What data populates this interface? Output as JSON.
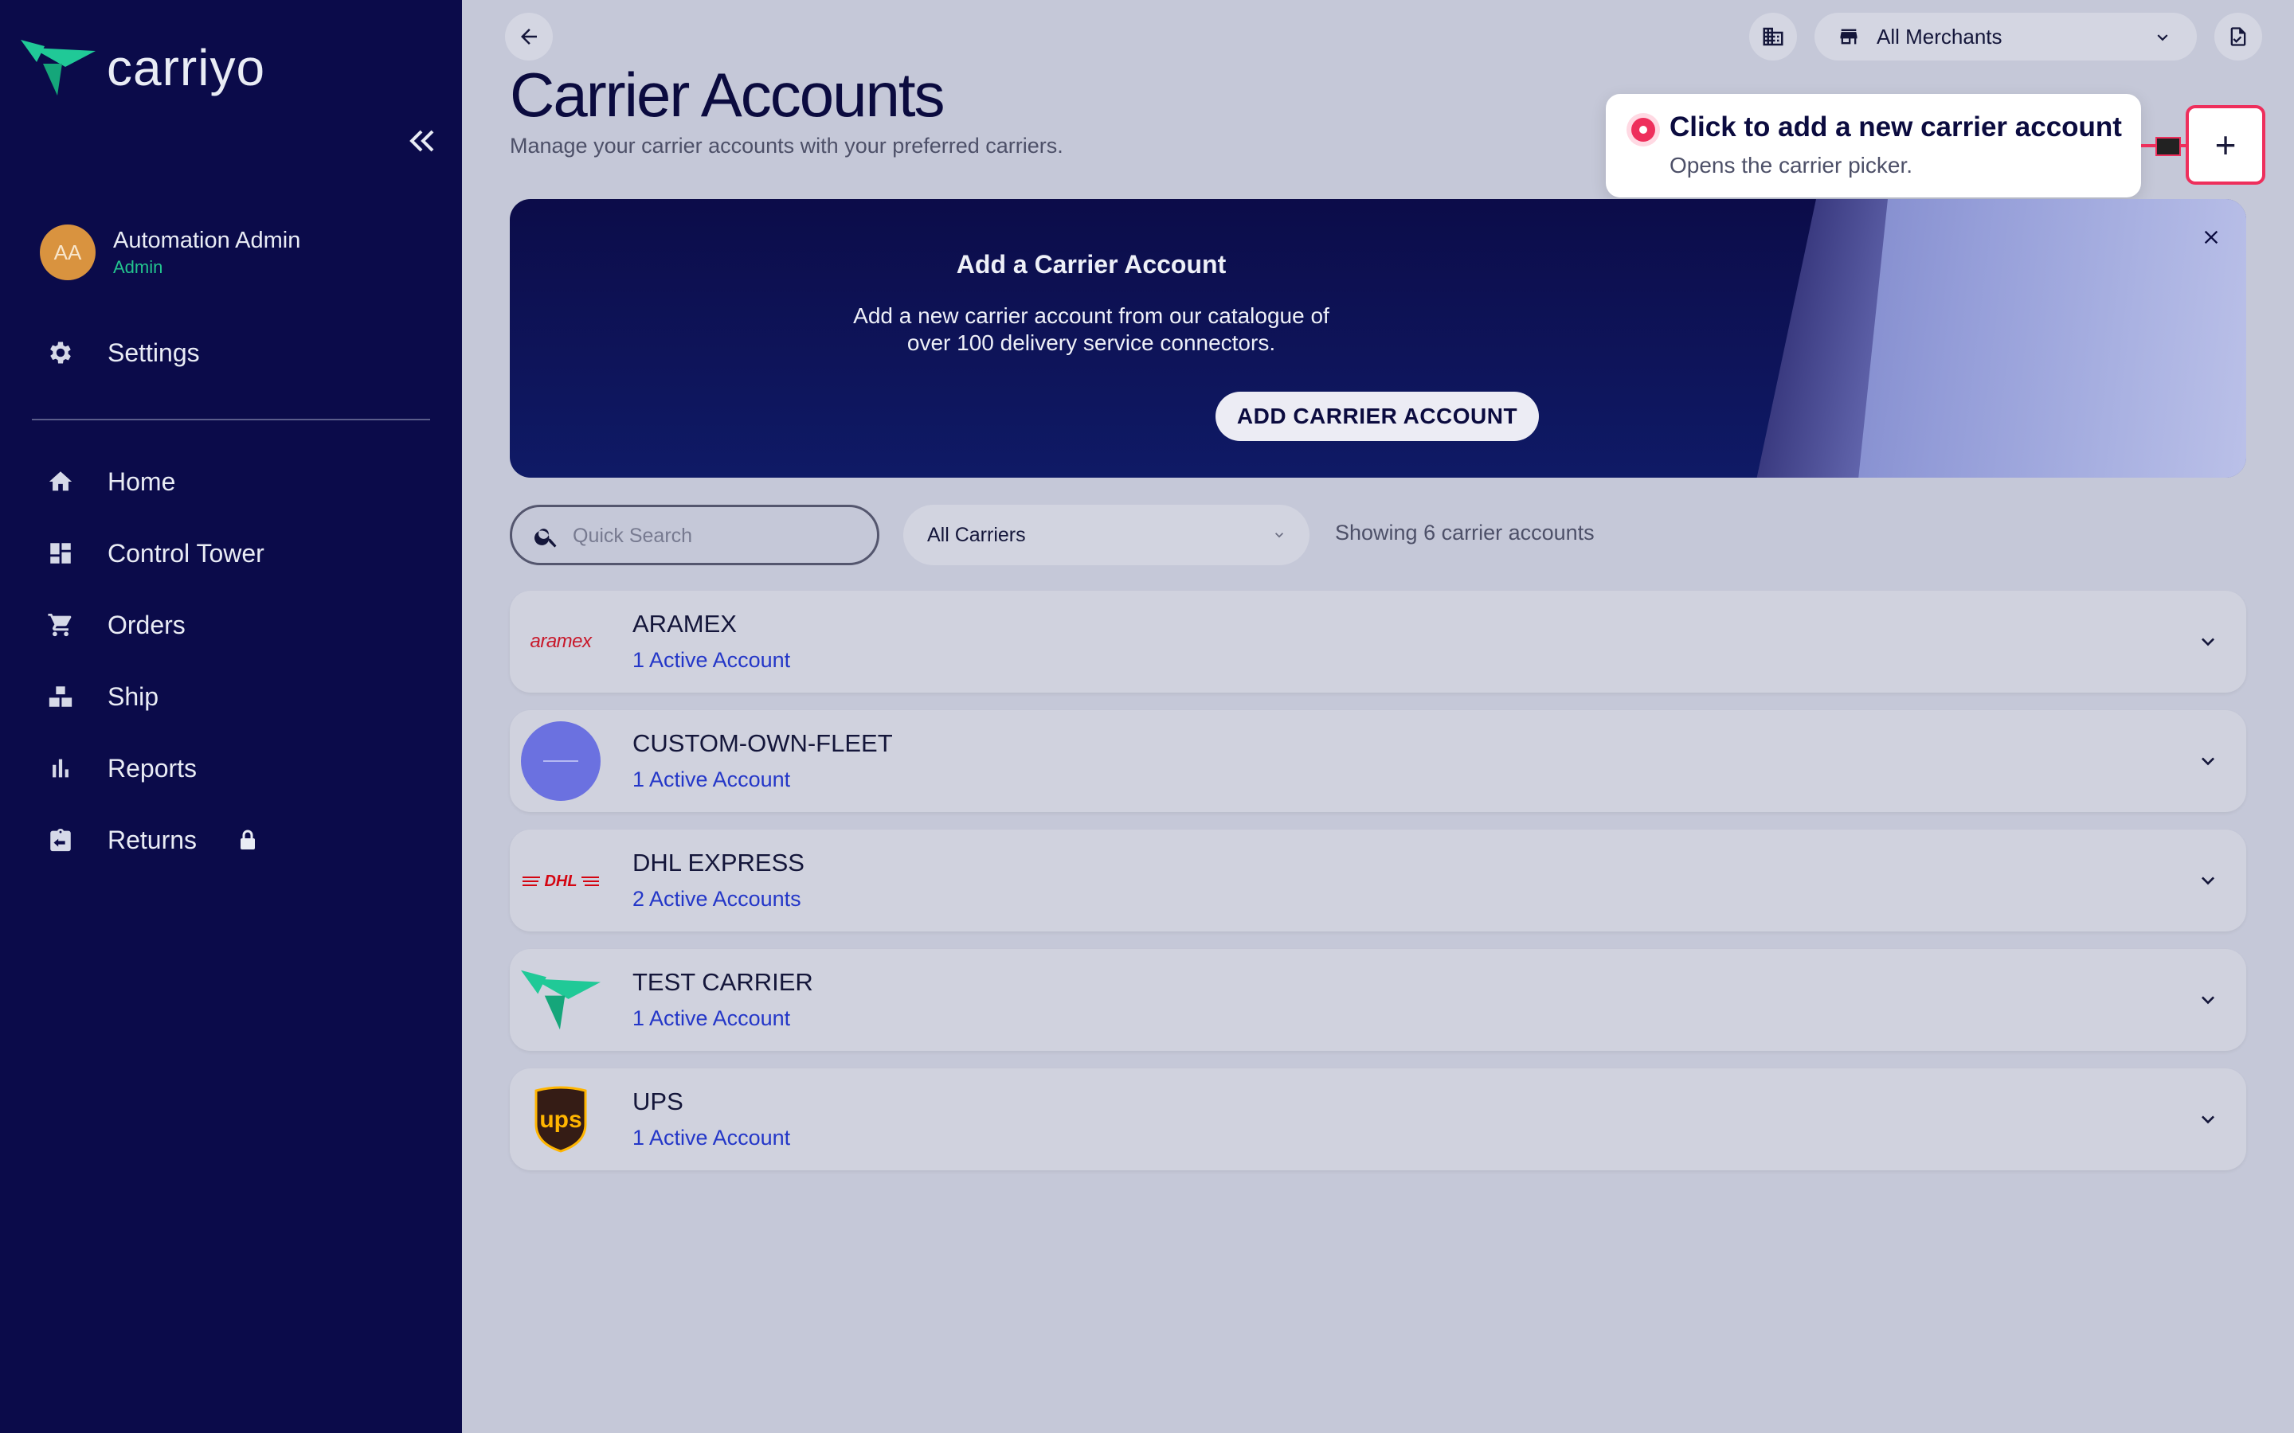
{
  "brand": {
    "name": "carriyo",
    "accent": "#20c997",
    "sidebar_bg": "#0b0b4a"
  },
  "user": {
    "initials": "AA",
    "name": "Automation Admin",
    "role": "Admin"
  },
  "sidebar": {
    "settings_label": "Settings",
    "items": [
      {
        "label": "Home",
        "icon": "home-icon"
      },
      {
        "label": "Control Tower",
        "icon": "dashboard-icon"
      },
      {
        "label": "Orders",
        "icon": "cart-icon"
      },
      {
        "label": "Ship",
        "icon": "ship-icon"
      },
      {
        "label": "Reports",
        "icon": "bar-chart-icon"
      },
      {
        "label": "Returns",
        "icon": "returns-icon",
        "locked": true
      }
    ]
  },
  "header": {
    "title": "Carrier Accounts",
    "subtitle": "Manage your carrier accounts with your preferred carriers.",
    "merchant_select": "All Merchants"
  },
  "tooltip": {
    "title": "Click to add a new carrier account",
    "text": "Opens the carrier picker.",
    "color": "#ee2f5c"
  },
  "add_button": {
    "symbol": "+"
  },
  "banner": {
    "title": "Add a Carrier Account",
    "text_line1": "Add a new carrier account from our catalogue of",
    "text_line2": "over 100 delivery service connectors.",
    "button_label": "ADD CARRIER ACCOUNT"
  },
  "filters": {
    "search_placeholder": "Quick Search",
    "carrier_select": "All Carriers",
    "showing_text": "Showing 6 carrier accounts"
  },
  "carriers": [
    {
      "name": "ARAMEX",
      "accounts": "1 Active Account",
      "logo_text": "aramex"
    },
    {
      "name": "CUSTOM-OWN-FLEET",
      "accounts": "1 Active Account",
      "logo_text": ""
    },
    {
      "name": "DHL EXPRESS",
      "accounts": "2 Active Accounts",
      "logo_text": "DHL"
    },
    {
      "name": "TEST CARRIER",
      "accounts": "1 Active Account",
      "logo_text": ""
    },
    {
      "name": "UPS",
      "accounts": "1 Active Account",
      "logo_text": "ups"
    }
  ]
}
